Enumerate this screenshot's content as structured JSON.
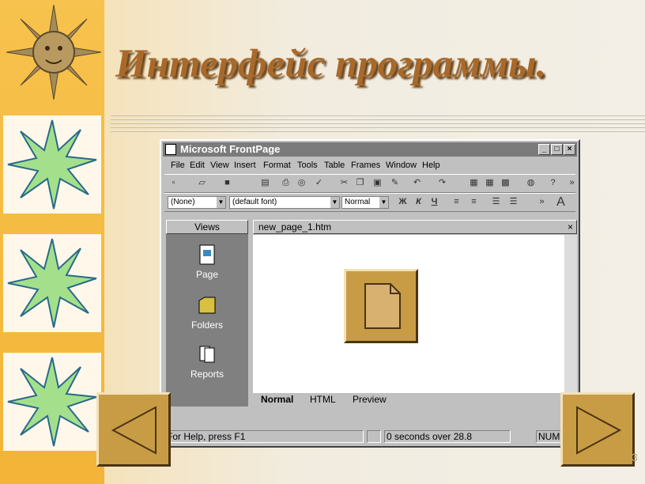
{
  "slide": {
    "title": "Интерфейс программы.",
    "slide_number": "3"
  },
  "window": {
    "title": "Microsoft FrontPage",
    "controls": {
      "minimize": "_",
      "maximize": "□",
      "close": "×"
    }
  },
  "menu": [
    "File",
    "Edit",
    "View",
    "Insert",
    "Format",
    "Tools",
    "Table",
    "Frames",
    "Window",
    "Help"
  ],
  "format_toolbar": {
    "style_combo": "(None)",
    "font_combo": "(default font)",
    "size_combo": "Normal",
    "bold": "Ж",
    "italic": "К",
    "underline": "Ч"
  },
  "views_panel": {
    "header": "Views",
    "items": [
      {
        "label": "Page",
        "icon": "page-view-icon"
      },
      {
        "label": "Folders",
        "icon": "folder-icon"
      },
      {
        "label": "Reports",
        "icon": "reports-icon"
      }
    ]
  },
  "document": {
    "tab_title": "new_page_1.htm",
    "close": "×",
    "bottom_tabs": [
      "Normal",
      "HTML",
      "Preview"
    ]
  },
  "status_bar": {
    "help_text": "For Help, press F1",
    "timing": "0 seconds over 28.8",
    "num": "NUM"
  },
  "nav": {
    "back_icon": "triangle-left-icon",
    "forward_icon": "triangle-right-icon",
    "document_icon": "document-icon"
  },
  "colors": {
    "title": "#a8692a",
    "titlebar": "#7b7b7b",
    "window_face": "#c0c0c0",
    "nav_button": "#c79c45",
    "star_green": "#a4e08c"
  }
}
